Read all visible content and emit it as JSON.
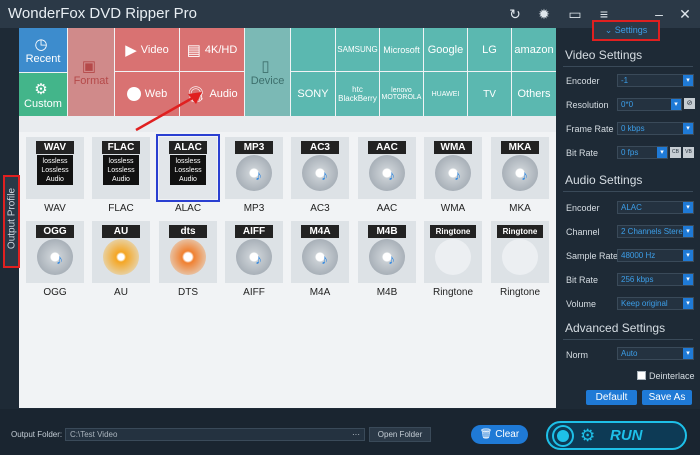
{
  "app": {
    "title": "WonderFox DVD Ripper Pro"
  },
  "titlebar_icons": [
    "refresh-icon",
    "gear-icon",
    "chat-icon",
    "menu-icon",
    "minimize-icon",
    "close-icon"
  ],
  "side_tab": {
    "label": "Output Profile"
  },
  "categories": {
    "recent": "Recent",
    "custom": "Custom",
    "format": "Format",
    "video": "Video",
    "web": "Web",
    "hd": "4K/HD",
    "audio": "Audio",
    "device": "Device"
  },
  "brands": [
    "SAMSUNG",
    "Microsoft",
    "Google",
    "LG",
    "amazon",
    "SONY",
    "htc BlackBerry",
    "lenovo MOTOROLA",
    "HUAWEI",
    "TV",
    "Others"
  ],
  "formats_row1": [
    {
      "badge": "WAV",
      "label": "WAV",
      "lossless": true
    },
    {
      "badge": "FLAC",
      "label": "FLAC",
      "lossless": true
    },
    {
      "badge": "ALAC",
      "label": "ALAC",
      "lossless": true
    },
    {
      "badge": "MP3",
      "label": "MP3",
      "lossless": false
    },
    {
      "badge": "AC3",
      "label": "AC3",
      "lossless": false
    },
    {
      "badge": "AAC",
      "label": "AAC",
      "lossless": false
    },
    {
      "badge": "WMA",
      "label": "WMA",
      "lossless": false
    },
    {
      "badge": "MKA",
      "label": "MKA",
      "lossless": false
    }
  ],
  "formats_row2": [
    {
      "badge": "OGG",
      "label": "OGG"
    },
    {
      "badge": "AU",
      "label": "AU"
    },
    {
      "badge": "dts",
      "label": "DTS"
    },
    {
      "badge": "AIFF",
      "label": "AIFF"
    },
    {
      "badge": "M4A",
      "label": "M4A"
    },
    {
      "badge": "M4B",
      "label": "M4B"
    },
    {
      "badge": "Ringtone",
      "label": "Ringtone"
    },
    {
      "badge": "Ringtone",
      "label": "Ringtone"
    }
  ],
  "lossless_text": "lossless Lossless Audio",
  "settings": {
    "toggle_label": "Settings",
    "video_title": "Video Settings",
    "encoder_label": "Encoder",
    "encoder_value": "-1",
    "resolution_label": "Resolution",
    "resolution_value": "0*0",
    "framerate_label": "Frame Rate",
    "framerate_value": "0 kbps",
    "bitrate_label": "Bit Rate",
    "bitrate_value": "0 fps",
    "audio_title": "Audio Settings",
    "a_encoder_label": "Encoder",
    "a_encoder_value": "ALAC",
    "channel_label": "Channel",
    "channel_value": "2 Channels Stere",
    "samplerate_label": "Sample Rate",
    "samplerate_value": "48000 Hz",
    "a_bitrate_label": "Bit Rate",
    "a_bitrate_value": "256 kbps",
    "volume_label": "Volume",
    "volume_value": "Keep original",
    "advanced_title": "Advanced Settings",
    "norm_label": "Norm",
    "norm_value": "Auto",
    "deinterlace_label": "Deinterlace",
    "default_btn": "Default",
    "saveas_btn": "Save As"
  },
  "bottom": {
    "output_folder_label": "Output Folder:",
    "output_folder_value": "C:\\Test Video",
    "dots": "···",
    "open_folder": "Open Folder",
    "clear": "Clear",
    "run": "RUN"
  }
}
